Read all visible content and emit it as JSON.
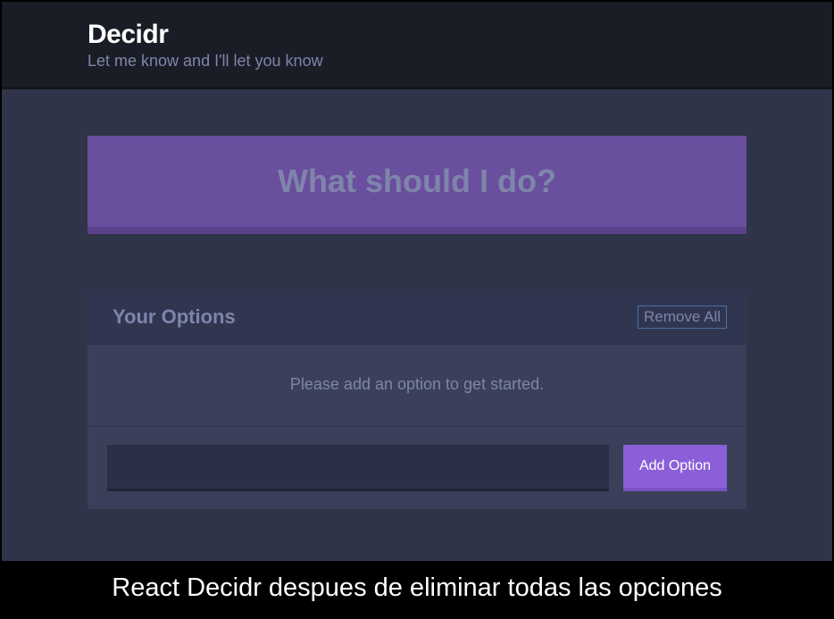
{
  "header": {
    "title": "Decidr",
    "subtitle": "Let me know and I'll let you know"
  },
  "cta": {
    "label": "What should I do?"
  },
  "options_widget": {
    "title": "Your Options",
    "remove_all_label": "Remove All",
    "empty_message": "Please add an option to get started.",
    "input_value": "",
    "add_button_label": "Add Option"
  },
  "caption": "React Decidr despues de eliminar todas las opciones"
}
